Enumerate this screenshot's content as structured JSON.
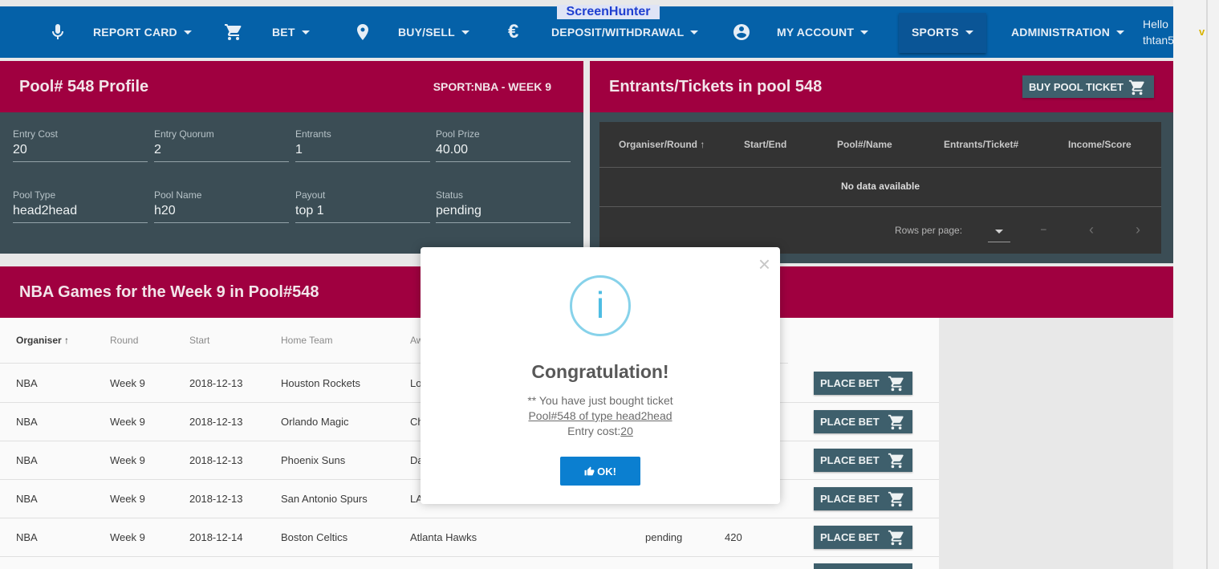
{
  "watermark": "ScreenHunter",
  "nav": {
    "items": [
      {
        "label": "REPORT CARD",
        "icon": "microphone-icon"
      },
      {
        "label": "BET",
        "icon": "cart-icon"
      },
      {
        "label": "BUY/SELL",
        "icon": "location-pin-icon"
      },
      {
        "label": "DEPOSIT/WITHDRAWAL",
        "icon": "euro-icon"
      },
      {
        "label": "MY ACCOUNT",
        "icon": "account-circle-icon"
      },
      {
        "label": "SPORTS"
      },
      {
        "label": "ADMINISTRATION"
      }
    ],
    "greeting": "Hello",
    "username": "thtan5",
    "extra": "v"
  },
  "profile": {
    "title": "Pool# 548 Profile",
    "sport": "SPORT:NBA - WEEK 9",
    "fields": [
      {
        "label": "Entry Cost",
        "value": "20"
      },
      {
        "label": "Entry Quorum",
        "value": "2"
      },
      {
        "label": "Entrants",
        "value": "1"
      },
      {
        "label": "Pool Prize",
        "value": "40.00"
      },
      {
        "label": "Pool Type",
        "value": "head2head"
      },
      {
        "label": "Pool Name",
        "value": "h20"
      },
      {
        "label": "Payout",
        "value": "top 1"
      },
      {
        "label": "Status",
        "value": "pending"
      }
    ]
  },
  "entrants": {
    "title": "Entrants/Tickets in pool 548",
    "buy_label": "BUY POOL TICKET",
    "columns": [
      "Organiser/Round",
      "Start/End",
      "Pool#/Name",
      "Entrants/Ticket#",
      "Income/Score"
    ],
    "empty": "No data available",
    "rows_per_page": "Rows per page:",
    "range": "–"
  },
  "games": {
    "title": "NBA Games for the Week 9 in Pool#548",
    "columns": [
      "Organiser",
      "Round",
      "Start",
      "Home Team",
      "Aw"
    ],
    "place_label": "PLACE BET",
    "rows": [
      {
        "organiser": "NBA",
        "round": "Week 9",
        "start": "2018-12-13",
        "home": "Houston Rockets",
        "away": "Lo",
        "status": "",
        "value": ""
      },
      {
        "organiser": "NBA",
        "round": "Week 9",
        "start": "2018-12-13",
        "home": "Orlando Magic",
        "away": "Ch",
        "status": "",
        "value": ""
      },
      {
        "organiser": "NBA",
        "round": "Week 9",
        "start": "2018-12-13",
        "home": "Phoenix Suns",
        "away": "Da",
        "status": "",
        "value": ""
      },
      {
        "organiser": "NBA",
        "round": "Week 9",
        "start": "2018-12-13",
        "home": "San Antonio Spurs",
        "away": "LA",
        "status": "",
        "value": ""
      },
      {
        "organiser": "NBA",
        "round": "Week 9",
        "start": "2018-12-14",
        "home": "Boston Celtics",
        "away": "Atlanta Hawks",
        "status": "pending",
        "value": "420"
      }
    ]
  },
  "modal": {
    "icon": "i",
    "title": "Congratulation!",
    "line1": "** You have just bought ticket",
    "line2": "Pool#548 of type head2head",
    "line3_prefix": "Entry cost:",
    "line3_value": "20",
    "ok_label": "OK!",
    "close": "×"
  },
  "colors": {
    "nav": "#0561a8",
    "header": "#a00040",
    "card": "#3b4d55",
    "button": "#3e5f6c",
    "ok": "#0b7fd0"
  }
}
